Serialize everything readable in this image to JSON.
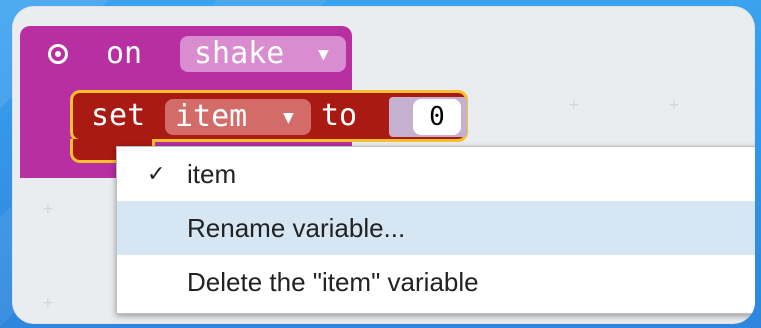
{
  "event_block": {
    "keyword": "on",
    "gesture_value": "shake",
    "dropdown_arrow": "▼",
    "color": "#b72fa0"
  },
  "set_block": {
    "keyword_set": "set",
    "variable_value": "item",
    "dropdown_arrow": "▼",
    "keyword_to": "to",
    "value": "0",
    "color": "#a91a12",
    "highlight_color": "#f7c02c"
  },
  "context_menu": {
    "items": [
      {
        "label": "item",
        "checked": true,
        "check_glyph": "✓"
      },
      {
        "label": "Rename variable...",
        "checked": false
      },
      {
        "label": "Delete the \"item\" variable",
        "checked": false
      }
    ],
    "highlight_color": "#d6e6f3"
  },
  "workspace": {
    "background": "#e9edf0",
    "frame_color": "#2f8fe0"
  }
}
